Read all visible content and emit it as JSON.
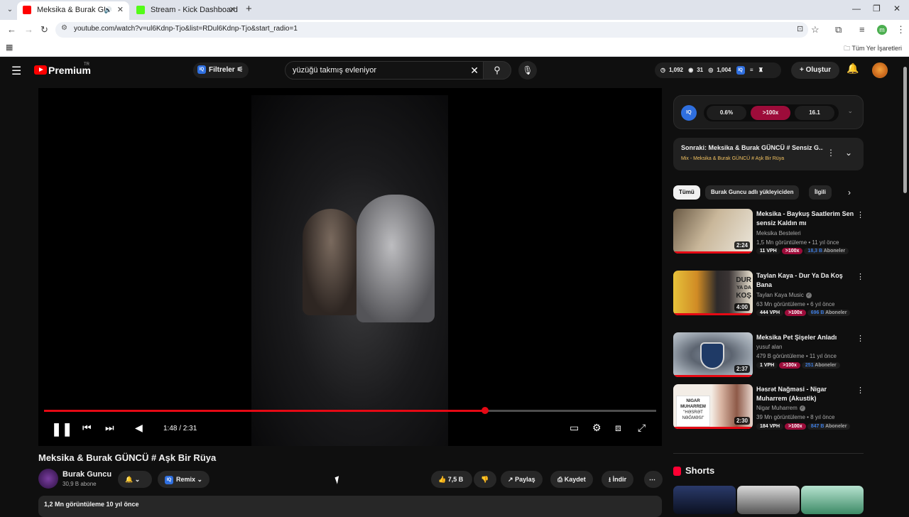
{
  "browser": {
    "tabs": [
      {
        "title": "Meksika & Burak GÜNCÜ # Aşk Bir Rüya",
        "active": true
      },
      {
        "title": "Stream - Kick Dashboard",
        "active": false
      }
    ],
    "url": "youtube.com/watch?v=ul6Kdnp-Tjo&list=RDul6Kdnp-Tjo&start_radio=1",
    "profile_initial": "m",
    "bookmarks_all": "Tüm Yer İşaretleri"
  },
  "header": {
    "logo_text": "Premium",
    "logo_country": "TR",
    "filters_label": "Filtreler",
    "search_query": "yüzüğü takmış evleniyor",
    "stats": {
      "views": "1,092",
      "eye": "31",
      "viewers": "1,004"
    },
    "create_label": "Oluştur"
  },
  "player": {
    "time": "1:48 / 2:31",
    "progress": 0.72
  },
  "video": {
    "title": "Meksika & Burak GÜNCÜ # Aşk Bir Rüya",
    "channel": "Burak Guncu",
    "subscribers": "30,9 B abone",
    "remix_label": "Remix",
    "likes": "7,5 B",
    "share_label": "Paylaş",
    "save_label": "Kaydet",
    "download_label": "İndir",
    "meta": "1,2 Mn görüntüleme  10 yıl önce"
  },
  "iq_panel": {
    "badge": "IQ",
    "metrics": [
      "0.6%",
      ">100x",
      "16.1"
    ]
  },
  "up_next": {
    "title": "Sonraki: Meksika & Burak GÜNCÜ # Sensiz G...",
    "mix": "Mix - Meksika & Burak GÜNCÜ # Aşk Bir Rüya"
  },
  "chips": [
    "Tümü",
    "Burak Guncu adlı yükleyiciden",
    "İlgili"
  ],
  "recommendations": [
    {
      "title": "Meksika - Baykuş Saatlerim Sen sensiz Kaldın mı",
      "channel": "Meksika Besteleri",
      "verified": false,
      "meta": "1,5 Mn görüntüleme • 11 yıl önce",
      "duration": "2:24",
      "vph": "11 VPH",
      "ratio": ">100x",
      "subs_num": "18,3 B",
      "subs_word": "Aboneler"
    },
    {
      "title": "Taylan Kaya - Dur Ya Da Koş Bana",
      "channel": "Taylan Kaya Music",
      "verified": true,
      "meta": "63 Mn görüntüleme • 6 yıl önce",
      "duration": "4:00",
      "vph": "444 VPH",
      "ratio": ">100x",
      "subs_num": "696 B",
      "subs_word": "Aboneler"
    },
    {
      "title": "Meksika Pet Şişeler Anladı",
      "channel": "yusuf alan",
      "verified": false,
      "meta": "479 B görüntüleme • 11 yıl önce",
      "duration": "2:37",
      "vph": "1 VPH",
      "ratio": ">100x",
      "subs_num": "251",
      "subs_word": "Aboneler"
    },
    {
      "title": "Həsrət Nağməsi - Nigar Muharrem (Akustik)",
      "channel": "Nigar Muharrem",
      "verified": true,
      "meta": "39 Mn görüntüleme • 8 yıl önce",
      "duration": "2:30",
      "vph": "184 VPH",
      "ratio": ">100x",
      "subs_num": "847 B",
      "subs_word": "Aboneler",
      "thumb_text": [
        "NIGAR",
        "MUHARREM",
        "\"HƏSRƏT",
        "NƏĞMƏSI\""
      ]
    }
  ],
  "shorts_label": "Shorts",
  "thumb_text_2": [
    "DUR",
    "YA DA",
    "KOŞ"
  ]
}
